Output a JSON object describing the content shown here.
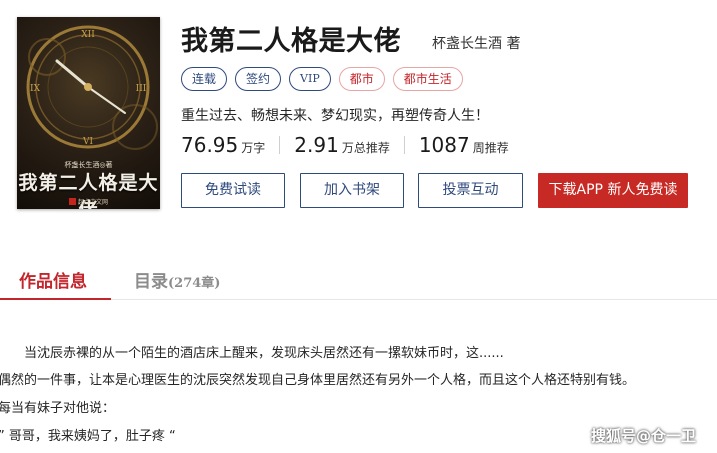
{
  "book": {
    "title": "我第二人格是大佬",
    "author": "杯盏长生酒 著",
    "intro": "重生过去、畅想未来、梦幻现实，再塑传奇人生！"
  },
  "cover": {
    "author_line": "杯盏长生酒◎著",
    "title": "我第二人格是大佬",
    "publisher": "起点中文网"
  },
  "tags": [
    "连载",
    "签约",
    "VIP",
    "都市",
    "都市生活"
  ],
  "stats": [
    {
      "value": "76.95",
      "unit": "万字"
    },
    {
      "value": "2.91",
      "unit": "万总推荐"
    },
    {
      "value": "1087",
      "unit": "周推荐"
    }
  ],
  "actions": {
    "read_free": "免费试读",
    "add_shelf": "加入书架",
    "vote": "投票互动",
    "download": "下载APP 新人免费读"
  },
  "tabs": {
    "info": "作品信息",
    "catalog": "目录",
    "catalog_count": "(274章)"
  },
  "synopsis": [
    "当沈辰赤裸的从一个陌生的酒店床上醒来，发现床头居然还有一摞软妹币时，这......",
    "偶然的一件事，让本是心理医生的沈辰突然发现自己身体里居然还有另外一个人格，而且这个人格还特别有钱。",
    "每当有妹子对他说：",
    "” 哥哥，我来姨妈了，肚子疼 “"
  ],
  "watermark": "搜狐号@仓一卫",
  "colors": {
    "accent_red": "#c2252b",
    "button_blue": "#2f4a7d",
    "primary_button": "#c72a24"
  }
}
